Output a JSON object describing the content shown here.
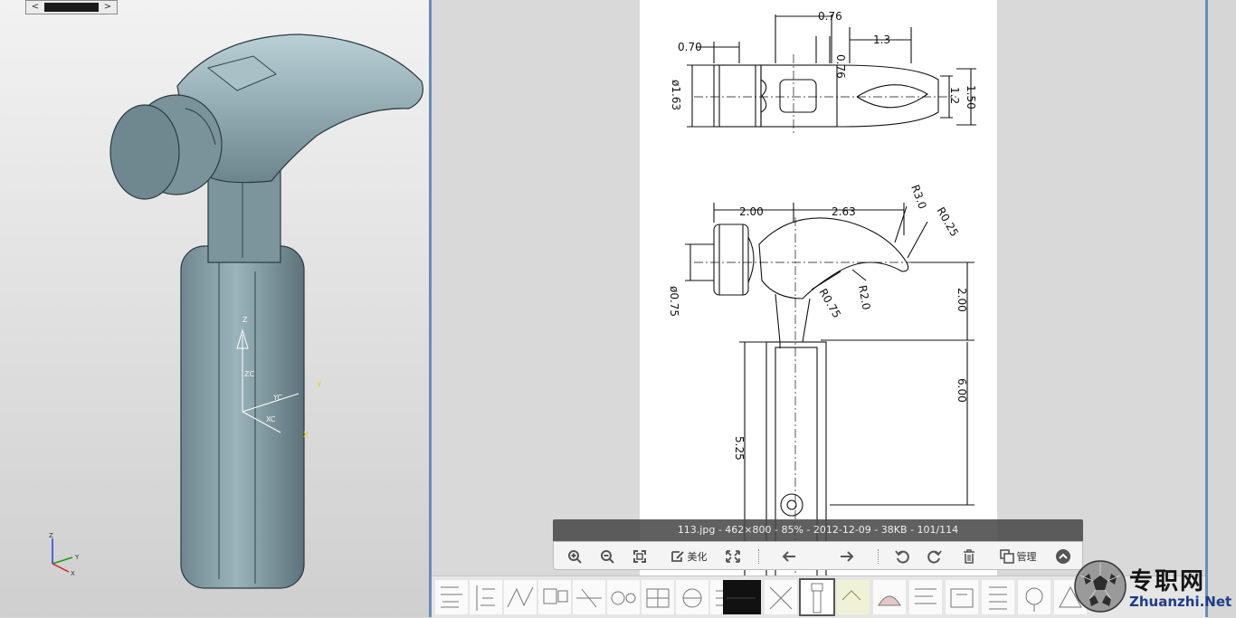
{
  "cad_view": {
    "scroll_left": "<",
    "scroll_right": ">",
    "csys_labels": [
      "Z",
      "ZC",
      "Y",
      "YC",
      "XC",
      "X"
    ],
    "triad_labels": [
      "Z",
      "Y",
      "X"
    ]
  },
  "drawing": {
    "dims": [
      "0.76",
      "0.70",
      "0.76",
      "1.3",
      "ø1.63",
      "1.2",
      "1.50",
      "2.00",
      "2.63",
      "R3.0",
      "R0.25",
      "ø0.75",
      "R0.75",
      "R2.0",
      "2.00",
      "6.00",
      "5.25"
    ]
  },
  "viewer": {
    "info": "113.jpg - 462×800 - 85% - 2012-12-09 - 38KB - 101/114",
    "beautify_label": "美化",
    "manage_label": "管理"
  },
  "toolbar_icons": [
    "zoom-in-icon",
    "zoom-out-icon",
    "fit-screen-icon",
    "beautify-icon",
    "fullscreen-icon",
    "previous-icon",
    "next-icon",
    "rotate-left-icon",
    "rotate-right-icon",
    "delete-icon",
    "manage-icon",
    "collapse-icon"
  ],
  "watermark": {
    "cn": "专职网",
    "en": "Zhuanzhi.Net"
  }
}
